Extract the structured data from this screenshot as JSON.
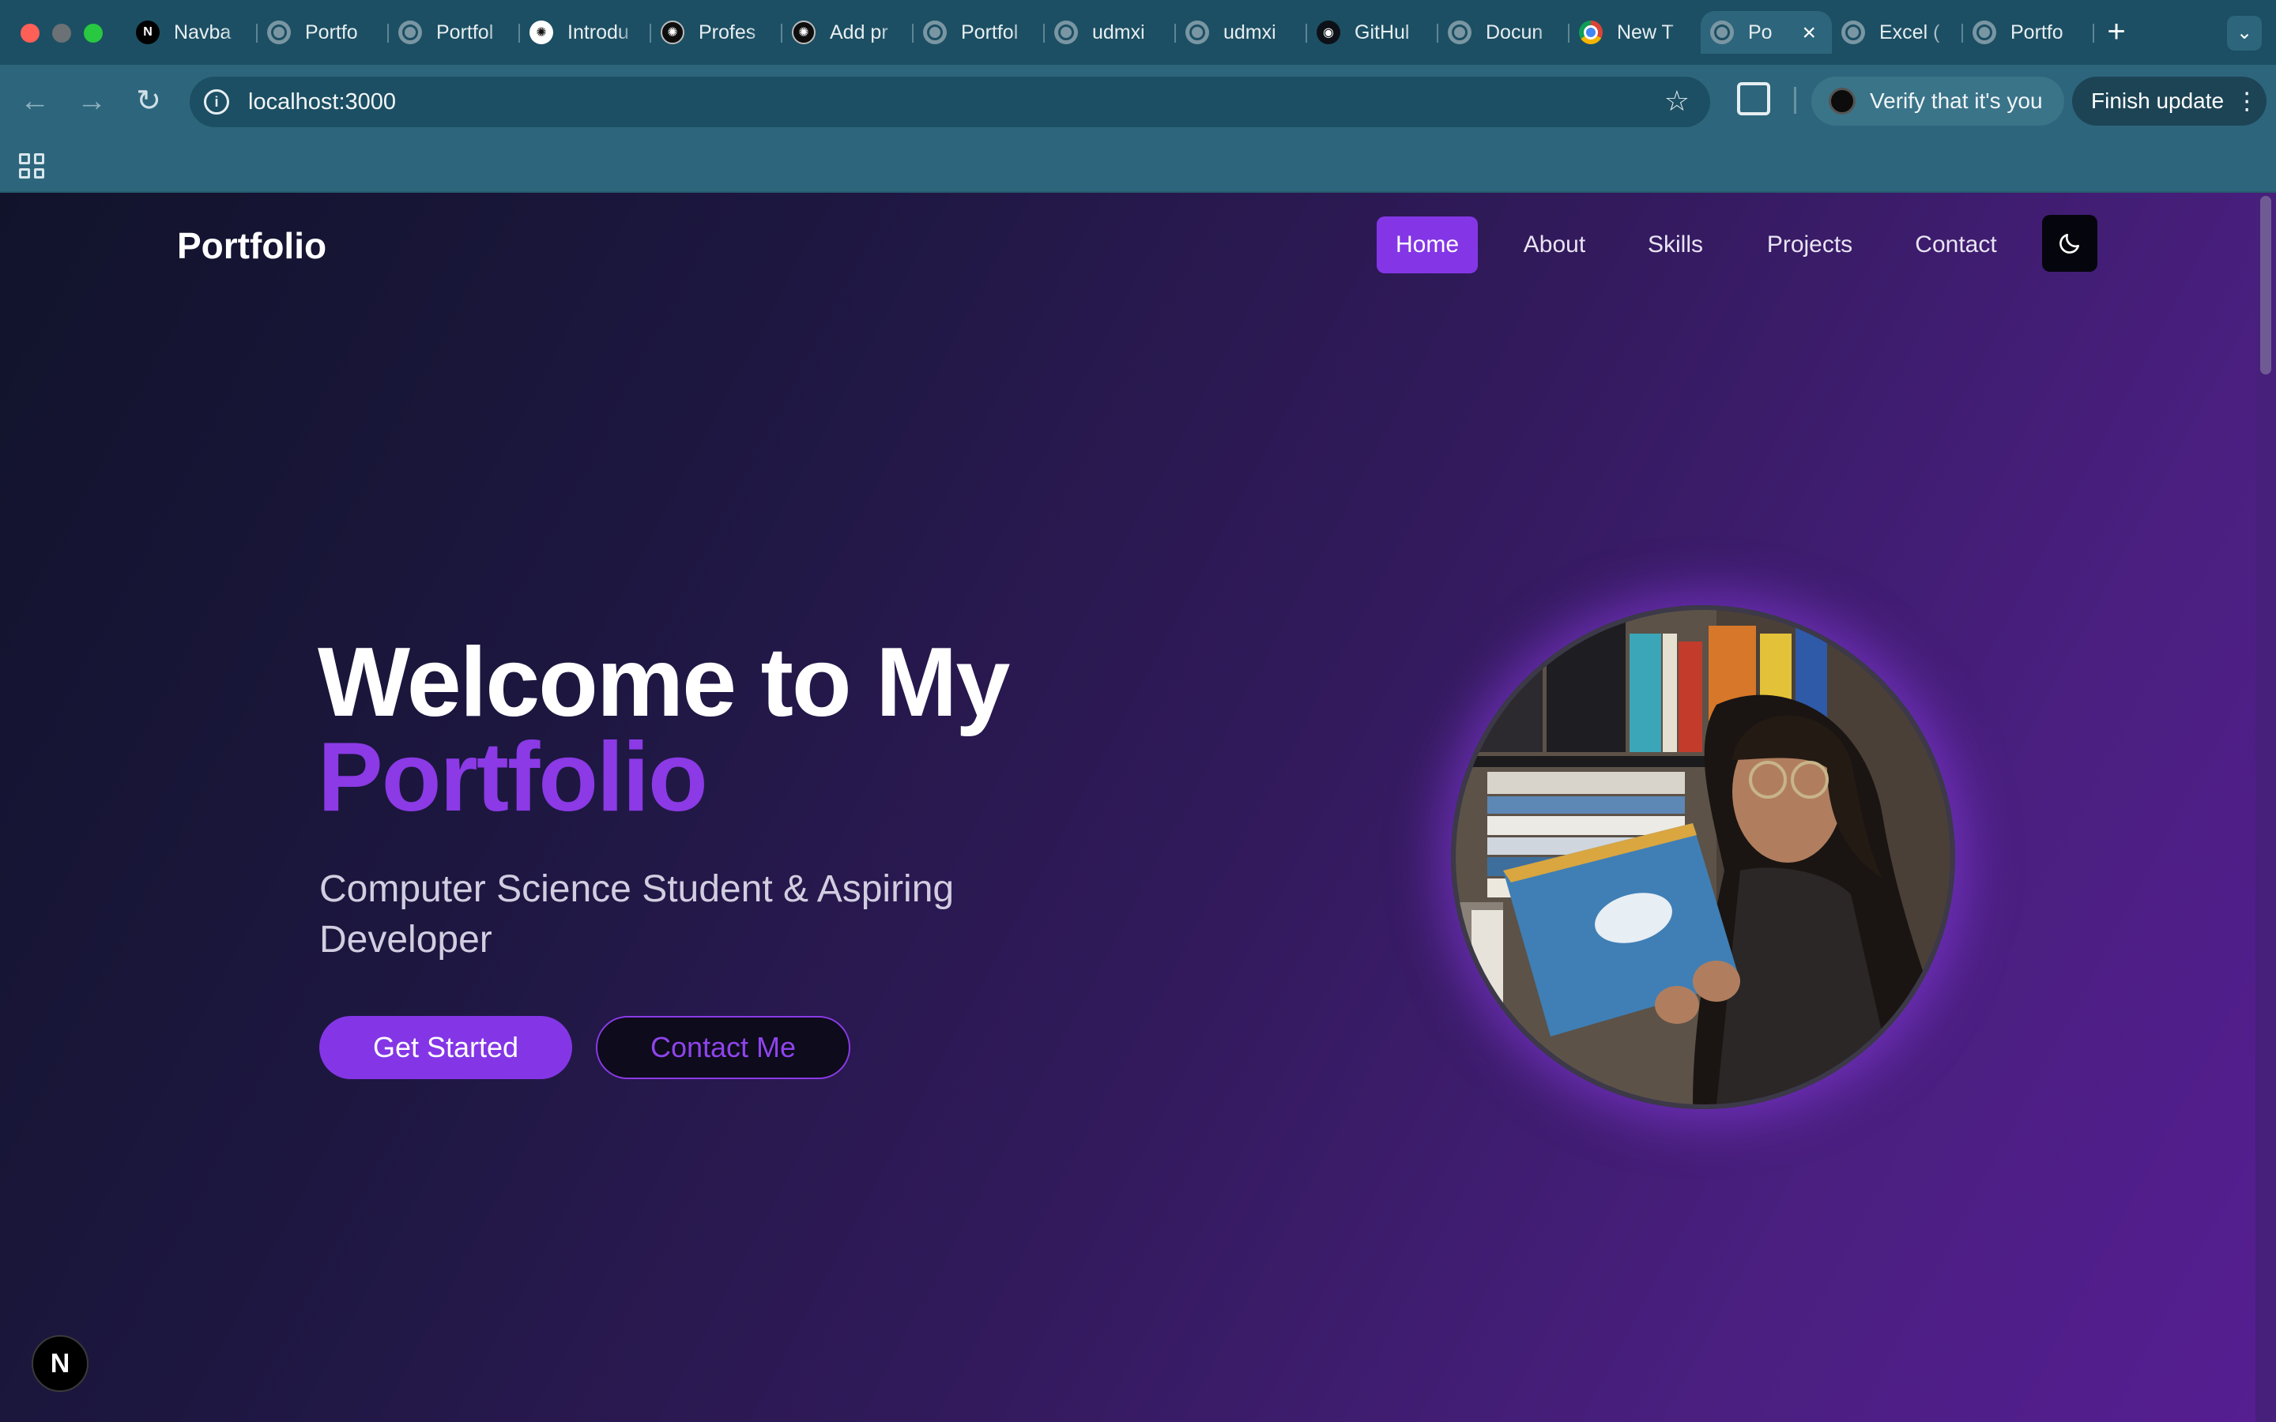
{
  "browser": {
    "tabs": [
      {
        "label": "Navba",
        "icon": "navbar-icon"
      },
      {
        "label": "Portfo",
        "icon": "globe-icon"
      },
      {
        "label": "Portfol",
        "icon": "globe-icon"
      },
      {
        "label": "Introdu",
        "icon": "openai-icon"
      },
      {
        "label": "Profes",
        "icon": "openai-icon"
      },
      {
        "label": "Add pr",
        "icon": "openai-icon"
      },
      {
        "label": "Portfol",
        "icon": "globe-icon"
      },
      {
        "label": "udmxi",
        "icon": "globe-icon"
      },
      {
        "label": "udmxi",
        "icon": "globe-icon"
      },
      {
        "label": "GitHul",
        "icon": "github-icon"
      },
      {
        "label": "Docun",
        "icon": "globe-icon"
      },
      {
        "label": "New T",
        "icon": "chrome-icon"
      },
      {
        "label": "Po",
        "icon": "globe-icon",
        "active": true
      },
      {
        "label": "Excel (",
        "icon": "globe-icon"
      },
      {
        "label": "Portfo",
        "icon": "globe-icon"
      }
    ],
    "new_tab": "+",
    "url": "localhost:3000",
    "verify_label": "Verify that it's you",
    "finish_update_label": "Finish update"
  },
  "page": {
    "brand": "Portfolio",
    "nav": {
      "home": "Home",
      "about": "About",
      "skills": "Skills",
      "projects": "Projects",
      "contact": "Contact"
    },
    "hero": {
      "title_line1": "Welcome to My",
      "title_line2": "Portfolio",
      "subtitle": "Computer Science Student & Aspiring Developer",
      "primary_cta": "Get Started",
      "secondary_cta": "Contact Me"
    },
    "next_badge": "N"
  },
  "colors": {
    "accent": "#8436e6",
    "chrome": "#2d667c",
    "tabstrip": "#1c4f63"
  }
}
